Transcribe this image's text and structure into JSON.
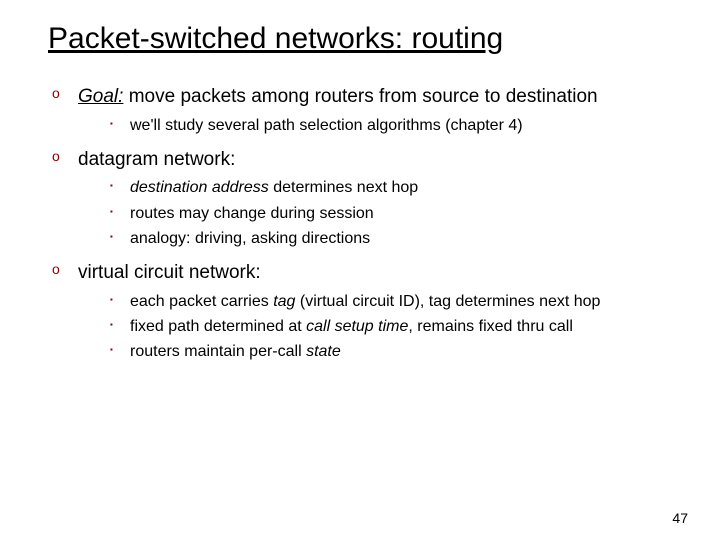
{
  "title": "Packet-switched networks: routing",
  "items": [
    {
      "lead": "Goal:",
      "rest": " move packets among routers from source to destination",
      "sub": [
        {
          "plain": "we'll study several path selection algorithms (chapter 4)"
        }
      ]
    },
    {
      "plain": "datagram network:",
      "sub": [
        {
          "emph": "destination address",
          "rest": " determines next hop"
        },
        {
          "plain": "routes may change during session"
        },
        {
          "plain": "analogy: driving, asking directions"
        }
      ]
    },
    {
      "plain": "virtual circuit network:",
      "sub": [
        {
          "emph": "tag",
          "pre": "each packet carries ",
          "rest": " (virtual circuit ID), tag determines next hop"
        },
        {
          "emph": "call setup time",
          "pre": "fixed path determined at ",
          "rest": ", remains fixed thru call"
        },
        {
          "emph": "state",
          "pre": "routers maintain per-call "
        }
      ]
    }
  ],
  "page_number": "47"
}
